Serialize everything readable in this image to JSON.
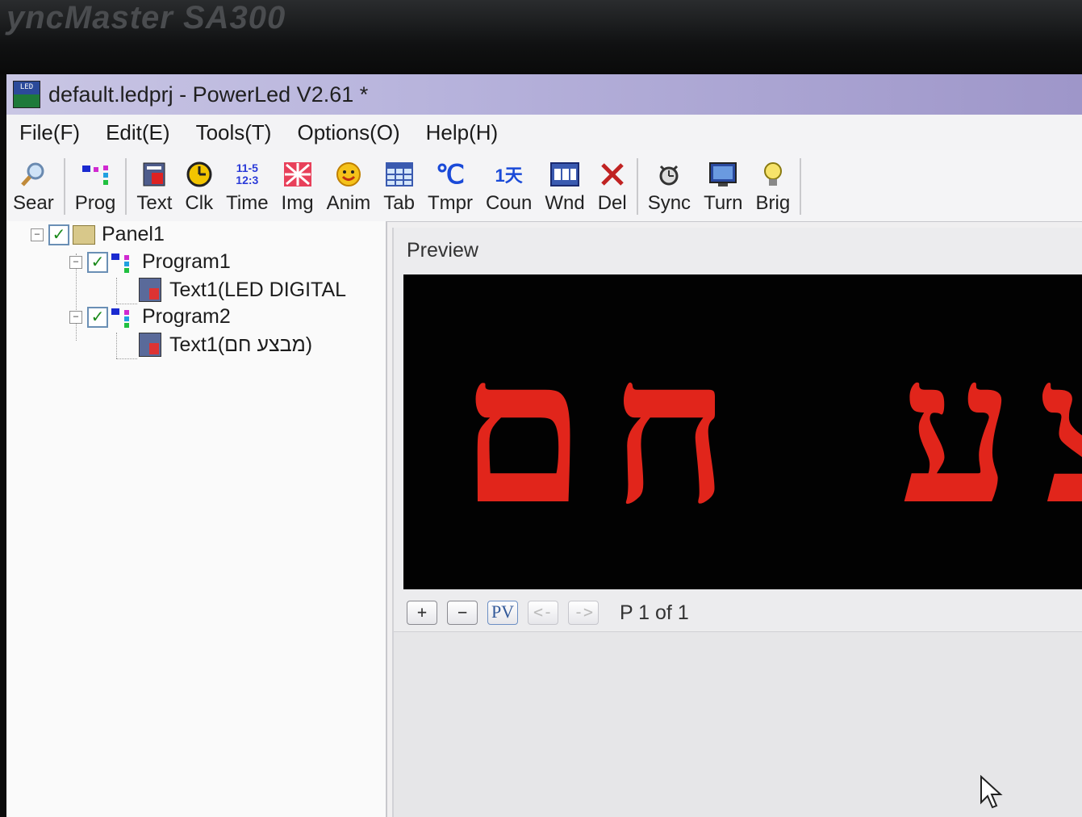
{
  "monitor": {
    "brand": "yncMaster SA300"
  },
  "window": {
    "title": "default.ledprj - PowerLed V2.61 *"
  },
  "menu": [
    "File(F)",
    "Edit(E)",
    "Tools(T)",
    "Options(O)",
    "Help(H)"
  ],
  "toolbar": [
    {
      "label": "Sear",
      "icon": "search-icon"
    },
    {
      "label": "Prog",
      "icon": "program-icon"
    },
    {
      "label": "Text",
      "icon": "text-icon"
    },
    {
      "label": "Clk",
      "icon": "clock-icon"
    },
    {
      "label": "Time",
      "icon": "time-icon",
      "icon_text": "11-5 12:3"
    },
    {
      "label": "Img",
      "icon": "image-icon"
    },
    {
      "label": "Anim",
      "icon": "animation-icon"
    },
    {
      "label": "Tab",
      "icon": "table-icon"
    },
    {
      "label": "Tmpr",
      "icon": "temperature-icon",
      "icon_text": "℃"
    },
    {
      "label": "Coun",
      "icon": "counter-icon",
      "icon_text": "1天"
    },
    {
      "label": "Wnd",
      "icon": "window-icon"
    },
    {
      "label": "Del",
      "icon": "delete-icon"
    },
    {
      "label": "Sync",
      "icon": "sync-icon"
    },
    {
      "label": "Turn",
      "icon": "turn-icon"
    },
    {
      "label": "Brig",
      "icon": "brightness-icon"
    }
  ],
  "tree": {
    "panel": "Panel1",
    "programs": [
      {
        "label": "Program1",
        "child": "Text1(LED DIGITAL"
      },
      {
        "label": "Program2",
        "child": "Text1(מבצע חם)"
      }
    ]
  },
  "preview": {
    "title": "Preview",
    "led_text": "מבצע חם",
    "led_color": "#e1251b",
    "controls": [
      "+",
      "−",
      "PV",
      "<-",
      "->"
    ],
    "page_info": "P 1 of 1"
  }
}
